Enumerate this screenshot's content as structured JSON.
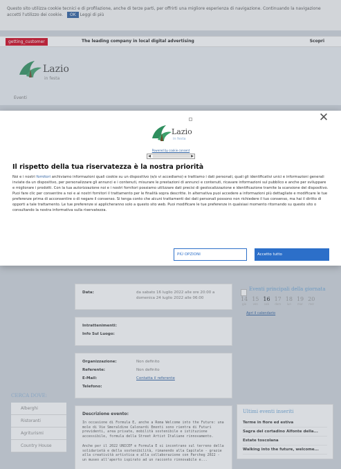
{
  "topnote": {
    "text": "Questo sito utilizza cookie tecnici e di profilazione, anche di terze parti, per offrirti una migliore esperienza di navigazione. Continuando la navigazione accetti l'utilizzo dei cookie.",
    "ok_label": "OK",
    "more_label": "Leggi di più"
  },
  "adbar": {
    "brand": "getting_customer",
    "slogan": "The leading company in local digital advertising",
    "cta": "Scopri"
  },
  "site": {
    "logo_word": "Lazio",
    "logo_sub": "in festa",
    "menu_label": "Eventi"
  },
  "modal": {
    "logo_word": "Lazio",
    "logo_sub": "in festa",
    "scroll_label": "Powered by cookie consent",
    "title": "Il rispetto della tua riservatezza è la nostra priorità",
    "body_pre": "Noi e i nostri ",
    "body_link": "fornitori",
    "body_post": " archiviamo informazioni quali cookie su un dispositivo (e/o vi accediamo) e trattiamo i dati personali, quali gli identificativi unici e informazioni generali inviate da un dispositivo, per personalizzare gli annunci e i contenuti, misurare le prestazioni di annunci e contenuti, ricavare informazioni sul pubblico e anche per sviluppare e migliorare i prodotti. Con la tua autorizzazione noi e i nostri fornitori possiamo utilizzare dati precisi di geolocalizzazione e identificazione tramite la scansione del dispositivo. Puoi fare clic per consentire a noi e ai nostri fornitori il trattamento per le finalità sopra descritte. In alternativa puoi accedere a informazioni più dettagliate e modificare le tue preferenze prima di acconsentire o di negare il consenso. Si tenga conto che alcuni trattamenti dei dati personali possono non richiedere il tuo consenso, ma hai il diritto di opporti a tale trattamento. Le tue preferenze si applicheranno solo a questo sito web. Puoi modificare le tue preferenze in qualsiasi momento ritornando su questo sito o consultando la nostra informativa sulla riservatezza.",
    "more_options": "PIÙ OPZIONI",
    "accept": "Accetto tutto"
  },
  "details": {
    "data_label": "Data:",
    "data_value": "da sabato 16 luglio 2022 alle ore 20:00 a domenica 24 luglio 2022 alle 06:00",
    "intrattenimenti_label": "Intrattenimenti:",
    "intrattenimenti_value": "",
    "info_label": "Info Sul Luogo:",
    "info_value": "",
    "org_label": "Organizzazione:",
    "org_value": "Non definito",
    "ref_label": "Referente:",
    "ref_value": "Non definito",
    "email_label": "E-Mail:",
    "email_value": "Contatta il referente",
    "tel_label": "Telefono:",
    "tel_value": "",
    "desc_title": "Descrizione evento:",
    "desc_1": "In occasione di Formula E, anche a Roma Welcome into the Future: una mole di Vie Smeraldine Calonardi Emonti sono rientra di Futuri previdenti, area private, mobilità sostenibile e istituzione accessibile, formula della Street Artist Italiane rinnovamento.",
    "desc_2": "Anche per il 2022 UNICEF e Formula E si incontrano sul terreno della solidarietà e della sostenibilità, rimanendo alla Capitale - grazie alla creatività artistica e alla collaborazione con Parcheg 2022 - un museo all'aperto ispirato ad un racconto rinnovabile e..."
  },
  "sidebar": {
    "events_title": "Eventi principali della giornata",
    "days": [
      {
        "num": "14",
        "dn": "gio"
      },
      {
        "num": "15",
        "dn": "ven"
      },
      {
        "num": "16",
        "dn": "sab"
      },
      {
        "num": "17",
        "dn": "dom"
      },
      {
        "num": "18",
        "dn": "lun"
      },
      {
        "num": "19",
        "dn": "mar"
      },
      {
        "num": "20",
        "dn": "mer"
      }
    ],
    "calendar_link": "Apri il calendario",
    "latest_title": "Ultimi eventi inseriti",
    "latest": [
      "Terme in fiore ed estiva",
      "Sagra del cortadino Alfonte della...",
      "Estate toscolana",
      "Walking into the future, welcome..."
    ]
  },
  "search": {
    "title": "CERCA DOVE:",
    "items": [
      "Alberghi",
      "Ristoranti",
      "Agriturismi",
      "Country House"
    ]
  }
}
